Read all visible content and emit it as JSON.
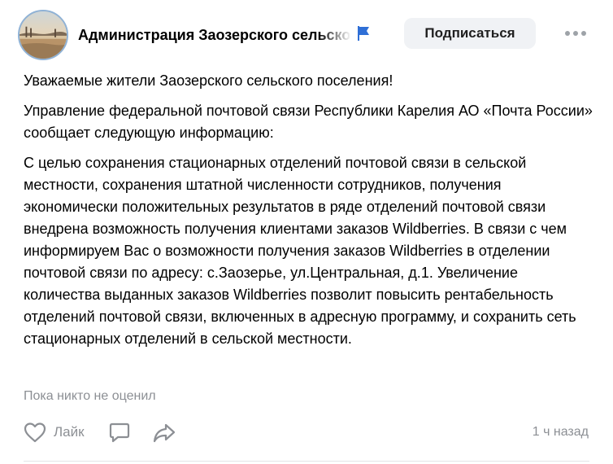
{
  "post": {
    "author": "Администрация Заозерского сельского поселения",
    "subscribe_label": "Подписаться",
    "paragraphs": [
      "Уважаемые жители Заозерского сельского поселения!",
      "Управление федеральной почтовой связи Республики Карелия АО «Почта России» сообщает следующую информацию:",
      "С целью сохранения стационарных отделений почтовой связи в сельской местности, сохранения штатной численности сотрудников, получения экономически положительных результатов в ряде отделений почтовой связи внедрена возможность получения клиентами заказов Wildberries. В связи с чем информируем Вас о возможности получения заказов Wildberries в отделении почтовой связи по адресу: с.Заозерье, ул.Центральная, д.1. Увеличение количества выданных заказов Wildberries позволит повысить рентабельность отделений почтовой связи, включенных в адресную программу, и сохранить сеть стационарных отделений в сельской местности."
    ],
    "likes_info": "Пока никто не оценил",
    "like_label": "Лайк",
    "timestamp": "1 ч назад"
  },
  "icons": {
    "avatar": "lake-landscape-avatar",
    "flag": "flag-icon",
    "more": "more-icon",
    "like": "heart-icon",
    "comment": "comment-icon",
    "share": "share-icon"
  },
  "colors": {
    "flag_blue": "#2f6fd6",
    "muted_text": "#8c8f94",
    "button_bg": "#f0f2f5",
    "icon_gray": "#8c8f94"
  }
}
